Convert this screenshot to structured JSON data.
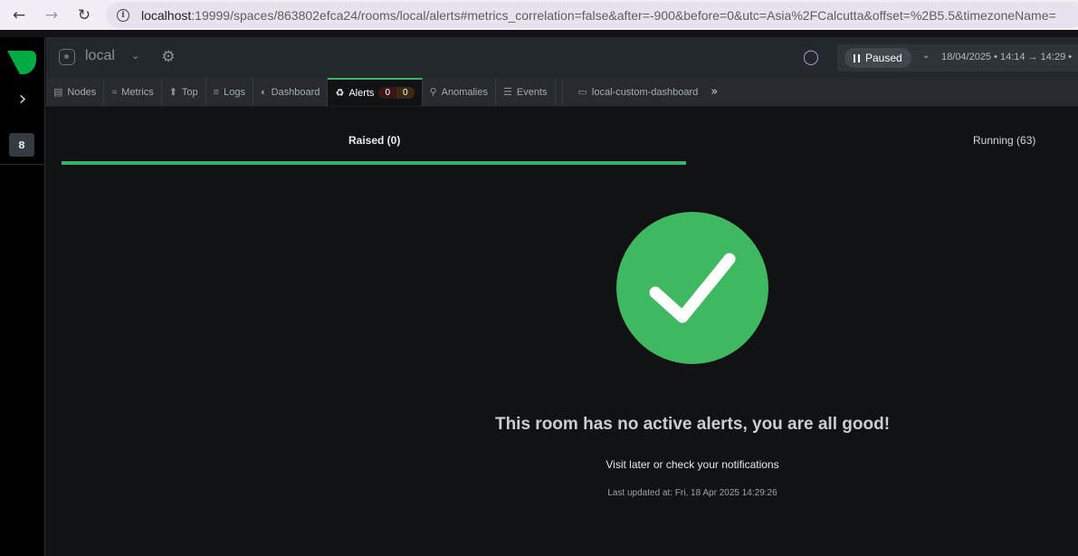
{
  "browser": {
    "url_host": "localhost",
    "url_rest": ":19999/spaces/863802efca24/rooms/local/alerts#metrics_correlation=false&after=-900&before=0&utc=Asia%2FCalcutta&offset=%2B5.5&timezoneName="
  },
  "rail": {
    "space_badge": "8"
  },
  "header": {
    "room_name": "local",
    "pause_label": "Paused",
    "time_range": "18/04/2025 • 14:14 → 14:29 •"
  },
  "tabs": [
    {
      "label": "Nodes",
      "icon": "nodes-icon"
    },
    {
      "label": "Metrics",
      "icon": "metrics-icon"
    },
    {
      "label": "Top",
      "icon": "top-icon"
    },
    {
      "label": "Logs",
      "icon": "logs-icon"
    },
    {
      "label": "Dashboard",
      "icon": "dashboard-icon"
    },
    {
      "label": "Alerts",
      "icon": "bell-icon",
      "critical": "0",
      "warning": "0"
    },
    {
      "label": "Anomalies",
      "icon": "anomalies-icon"
    },
    {
      "label": "Events",
      "icon": "events-icon"
    },
    {
      "label": "local-custom-dashboard",
      "icon": "custom-dashboard-icon"
    }
  ],
  "alerts": {
    "raised_tab": "Raised (0)",
    "running_tab": "Running (63)",
    "empty_title": "This room has no active alerts, you are all good!",
    "empty_subtitle": "Visit later or check your notifications",
    "last_updated": "Last updated at: Fri, 18 Apr 2025 14:29:26"
  },
  "colors": {
    "accent": "#3ab16d",
    "background": "#101213",
    "check_circle": "#40b862"
  }
}
